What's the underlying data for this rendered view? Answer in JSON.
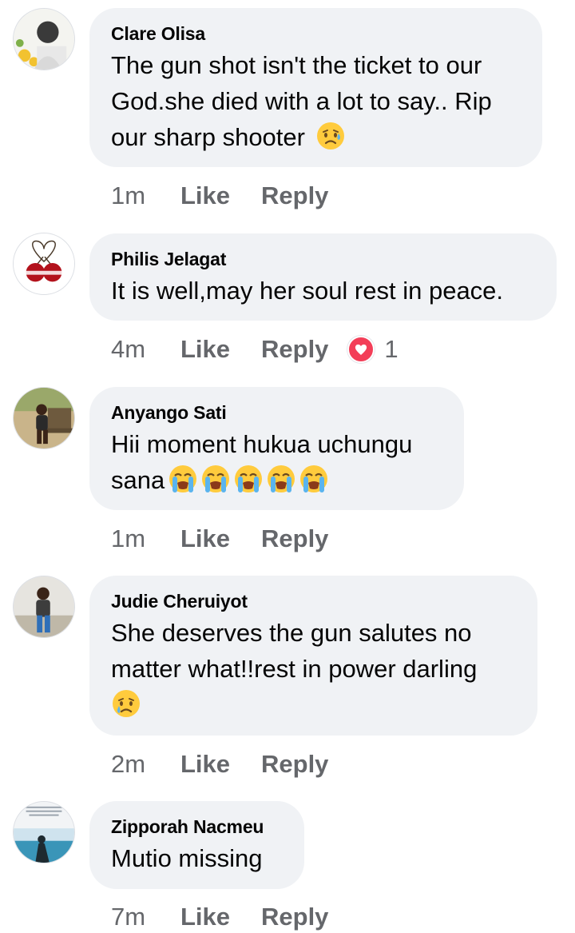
{
  "comments": [
    {
      "author": "Clare Olisa",
      "lines": [
        "The gun shot isn't the ticket to our",
        "God.she died with a lot to say.. Rip",
        "our sharp shooter"
      ],
      "emoji": [
        "sad-but-relieved-face"
      ],
      "time": "1m",
      "like_label": "Like",
      "reply_label": "Reply"
    },
    {
      "author": "Philis Jelagat",
      "lines": [
        "It is well,may her soul rest in peace."
      ],
      "emoji": [],
      "time": "4m",
      "like_label": "Like",
      "reply_label": "Reply",
      "reaction": {
        "icon": "heart-icon",
        "count": "1"
      }
    },
    {
      "author": "Anyango Sati",
      "lines": [
        "Hii moment hukua uchungu",
        "sana"
      ],
      "emoji": [
        "loudly-crying-face",
        "loudly-crying-face",
        "loudly-crying-face",
        "loudly-crying-face",
        "loudly-crying-face"
      ],
      "time": "1m",
      "like_label": "Like",
      "reply_label": "Reply"
    },
    {
      "author": "Judie Cheruiyot",
      "lines": [
        "She deserves the gun salutes no",
        "matter what!!rest in power darling",
        ""
      ],
      "emoji": [
        "crying-face"
      ],
      "time": "2m",
      "like_label": "Like",
      "reply_label": "Reply"
    },
    {
      "author": "Zipporah Nacmeu",
      "lines": [
        "Mutio missing"
      ],
      "emoji": [],
      "time": "7m",
      "like_label": "Like",
      "reply_label": "Reply"
    }
  ],
  "colors": {
    "bubble": "#f0f2f5",
    "text": "#050505",
    "meta": "#65676b",
    "heart": "#f33e58"
  }
}
